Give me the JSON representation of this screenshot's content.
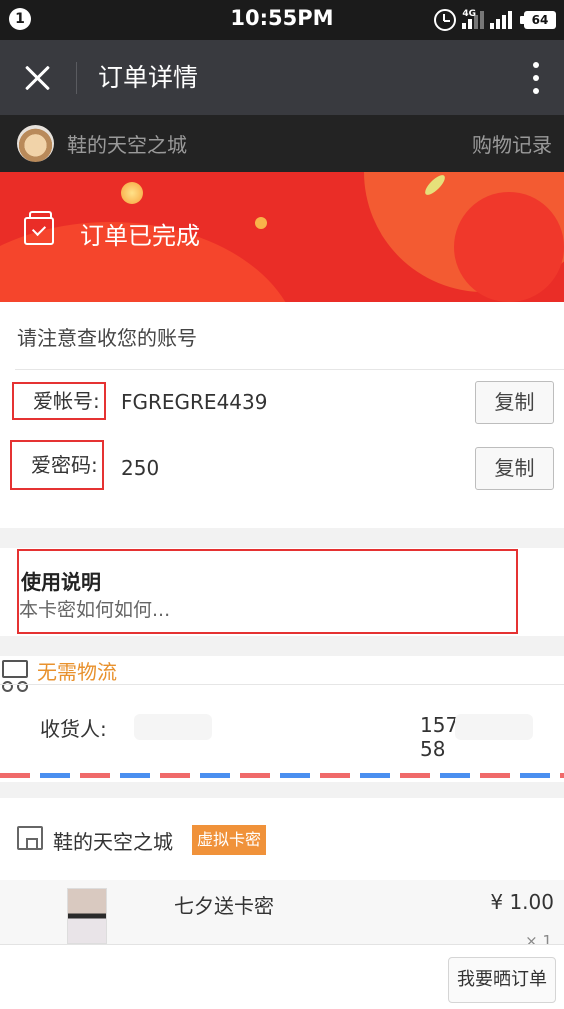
{
  "status_bar": {
    "notification_count": "1",
    "time": "10:55PM",
    "network": "4G",
    "battery": "64"
  },
  "header": {
    "title": "订单详情"
  },
  "shop_bar": {
    "shop_name": "鞋的天空之城",
    "history_link": "购物记录"
  },
  "banner": {
    "status": "订单已完成",
    "background_color": "#ea2d27"
  },
  "account_card": {
    "notice": "请注意查收您的账号",
    "fields": [
      {
        "label": "爱帐号:",
        "value": "FGREGRE4439",
        "copy_label": "复制"
      },
      {
        "label": "爱密码:",
        "value": "250",
        "copy_label": "复制"
      }
    ]
  },
  "usage": {
    "title": "使用说明",
    "description": "本卡密如何如何..."
  },
  "logistics": {
    "label": "无需物流",
    "receiver_label": "收货人:",
    "receiver_name": "",
    "phone_prefix": "157",
    "phone_suffix": "58",
    "accent_color": "#e8912d"
  },
  "shop": {
    "name": "鞋的天空之城",
    "tag": "虚拟卡密",
    "product": {
      "name": "七夕送卡密",
      "price": "¥ 1.00",
      "quantity": "× 1"
    }
  },
  "bottom_bar": {
    "share_button": "我要晒订单"
  }
}
